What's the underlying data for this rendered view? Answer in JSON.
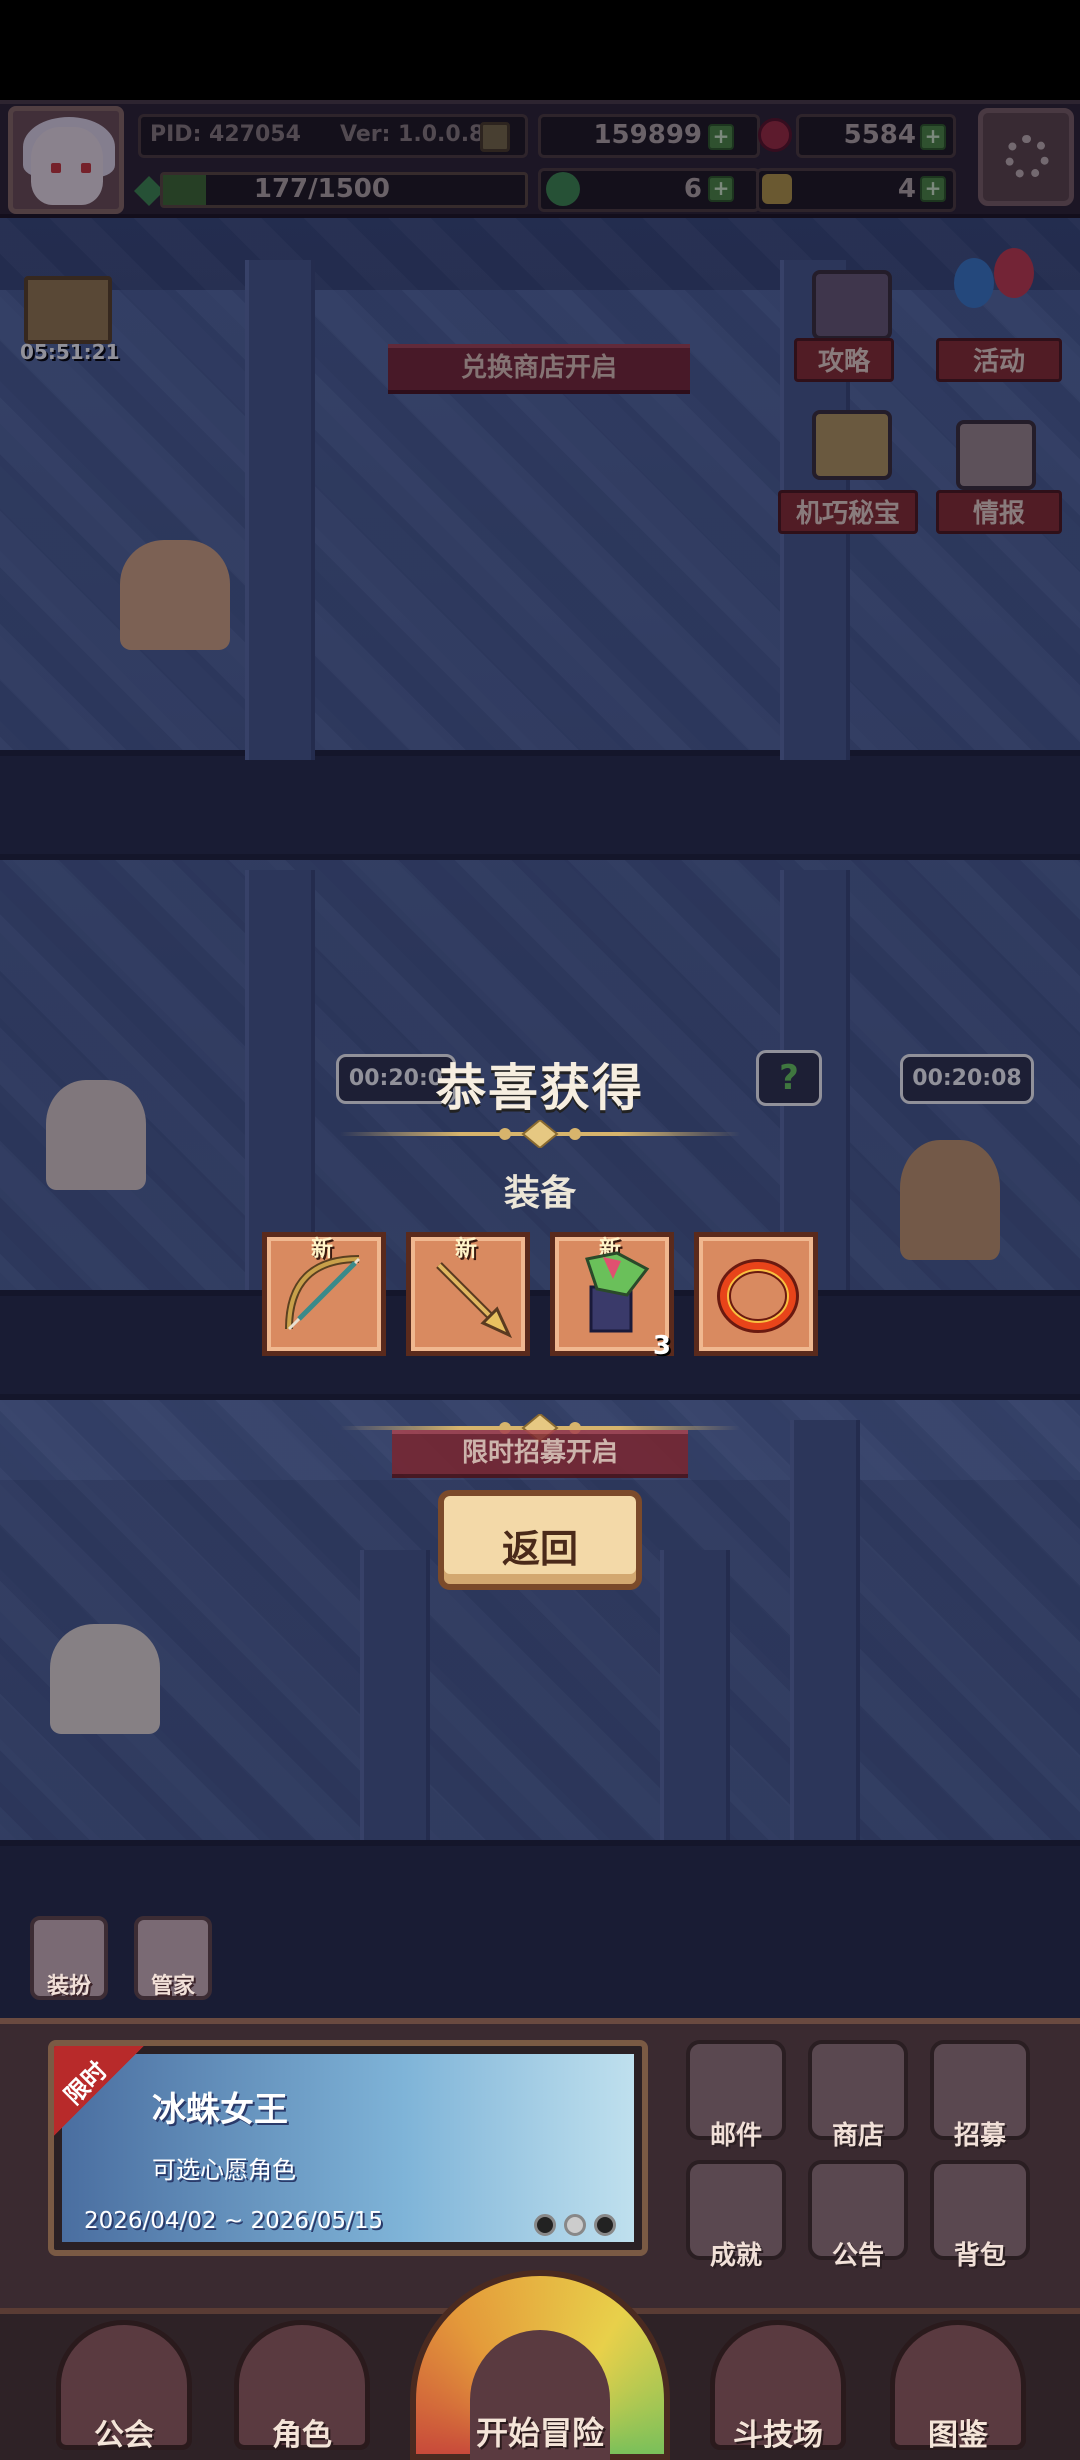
{
  "hud": {
    "pid_label": "PID: 427054",
    "version_label": "Ver: 1.0.0.8",
    "gold_amount": "159899",
    "gem_amount": "5584",
    "exp_text": "177/1500",
    "exp_progress": 0.118,
    "clover_amount": "6",
    "key_amount": "4"
  },
  "side": {
    "gift_timer": "05:51:21",
    "guide_label": "攻略",
    "event_label": "活动",
    "treasure_label": "机巧秘宝",
    "intel_label": "情报",
    "exchange_banner": "兑换商店开启",
    "recruit_banner": "限时招募开启"
  },
  "scene": {
    "timer_left": "00:20:0",
    "timer_right": "00:20:08",
    "question_mark": "?"
  },
  "reward": {
    "title": "恭喜获得",
    "category": "装备",
    "items": [
      {
        "name": "bow",
        "new_tag": "新",
        "count": ""
      },
      {
        "name": "arrow",
        "new_tag": "新",
        "count": ""
      },
      {
        "name": "outfit",
        "new_tag": "新",
        "count": "3"
      },
      {
        "name": "ring",
        "new_tag": "",
        "count": ""
      }
    ],
    "back_label": "返回"
  },
  "quick": {
    "dress_label": "装扮",
    "butler_label": "管家"
  },
  "event": {
    "limit_tag": "限时",
    "title": "冰蛛女王",
    "subtitle": "可选心愿角色",
    "date_range": "2026/04/02 ~ 2026/05/15"
  },
  "grid": {
    "mail_label": "邮件",
    "shop_label": "商店",
    "recruit_label": "招募",
    "achievement_label": "成就",
    "notice_label": "公告",
    "bag_label": "背包"
  },
  "nav": {
    "guild_label": "公会",
    "character_label": "角色",
    "start_label": "开始冒险",
    "arena_label": "斗技场",
    "codex_label": "图鉴"
  },
  "colors": {
    "accent_gold": "#d7b46c",
    "banner_red": "#7a2630",
    "item_orange": "#d98a60",
    "plus_green": "#4e8a3c"
  }
}
